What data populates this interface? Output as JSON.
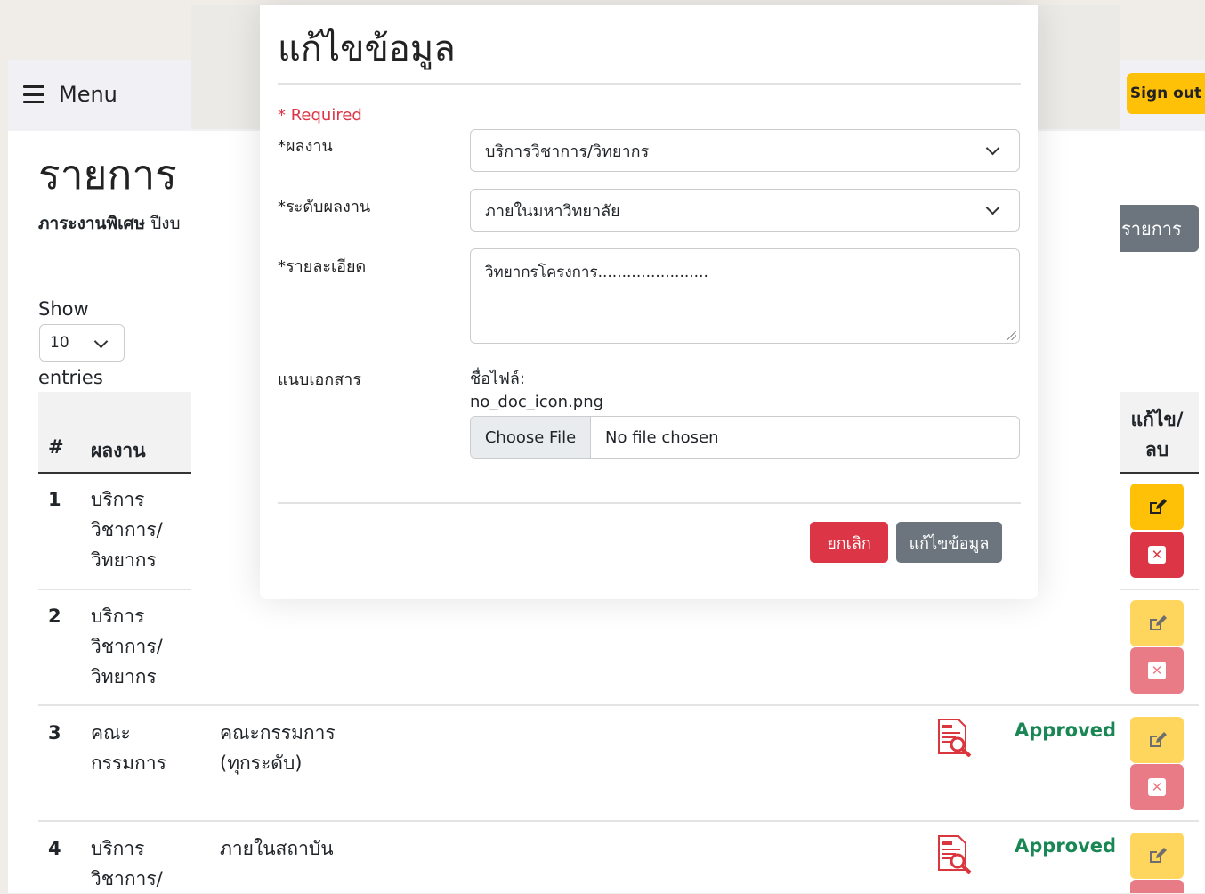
{
  "topbar": {
    "menu_label": "Menu",
    "signout_label": "Sign out"
  },
  "page": {
    "title": "รายการ",
    "subtitle_bold": "ภาระงานพิเศษ",
    "subtitle_rest": " ปีงบ",
    "add_button": "รายการ"
  },
  "table_controls": {
    "show_label": "Show",
    "entries_value": "10",
    "entries_label": "entries"
  },
  "table": {
    "headers": {
      "num": "#",
      "work": "ผลงาน",
      "edit_line1": "แก้ไข/",
      "edit_line2": "ลบ"
    },
    "rows": [
      {
        "num": "1",
        "work": [
          "บริการ",
          "วิชาการ/",
          "วิทยากร"
        ]
      },
      {
        "num": "2",
        "work": [
          "บริการ",
          "วิชาการ/",
          "วิทยากร"
        ]
      },
      {
        "num": "3",
        "work": [
          "คณะ",
          "กรรมการ"
        ],
        "level": [
          "คณะกรรมการ",
          "(ทุกระดับ)"
        ],
        "status": "Approved"
      },
      {
        "num": "4",
        "work": [
          "บริการ",
          "วิชาการ/"
        ],
        "level": [
          "ภายในสถาบัน"
        ],
        "status": "Approved"
      }
    ]
  },
  "modal": {
    "title": "แก้ไขข้อมูล",
    "required_note": "* Required",
    "fields": {
      "work_label": "*ผลงาน",
      "work_value": "บริการวิชาการ/วิทยากร",
      "level_label": "*ระดับผลงาน",
      "level_value": "ภายในมหาวิทยาลัย",
      "detail_label": "*รายละเอียด",
      "detail_value": "วิทยากรโครงการ.......................",
      "attach_label": "แนบเอกสาร",
      "filename_label": "ชื่อไฟล์:",
      "filename_value": "no_doc_icon.png",
      "choose_file": "Choose File",
      "no_file": "No file chosen"
    },
    "buttons": {
      "cancel": "ยกเลิก",
      "save": "แก้ไขข้อมูล"
    }
  },
  "colors": {
    "warning": "#ffc107",
    "danger": "#dc3545",
    "secondary": "#6c757d",
    "success": "#198754"
  }
}
